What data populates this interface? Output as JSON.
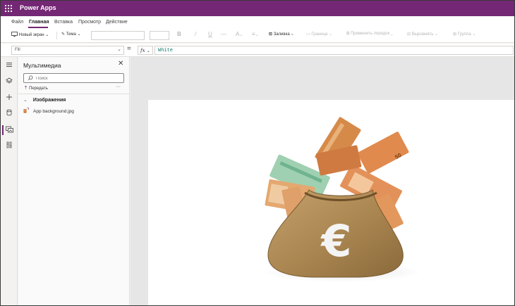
{
  "app": {
    "title": "Power Apps"
  },
  "menu": {
    "items": [
      "Файл",
      "Главная",
      "Вставка",
      "Просмотр",
      "Действие"
    ],
    "active_index": 1
  },
  "toolbar": {
    "new_screen": "Новый экран",
    "theme": "Тема",
    "bold": "B",
    "italic": "/",
    "underline": "U",
    "strike": "—",
    "font_color": "A",
    "align": "≡",
    "fill": "Заливка",
    "border": "Граница",
    "reorder": "Применить порядок",
    "arrange": "Выровнять",
    "group": "Группа"
  },
  "formula": {
    "property": "Fill",
    "equals": "=",
    "fx": "fx",
    "value": "White"
  },
  "media_panel": {
    "title": "Мультимедиа",
    "search_placeholder": "Поиск",
    "upload_label": "Передать",
    "more": "···",
    "group_label": "Изображения",
    "files": [
      "App background.jpg"
    ]
  },
  "canvas": {
    "background": "#ffffff",
    "image_alt": "Money bag with euro banknotes",
    "bag_symbol": "€",
    "note_value": "50"
  },
  "colors": {
    "titlebar": "#742774",
    "accent": "#742774",
    "workspace": "#e6e6e6"
  },
  "icons": {
    "rail": [
      "hamburger-icon",
      "layers-icon",
      "plus-icon",
      "database-icon",
      "media-icon",
      "tools-icon"
    ]
  }
}
